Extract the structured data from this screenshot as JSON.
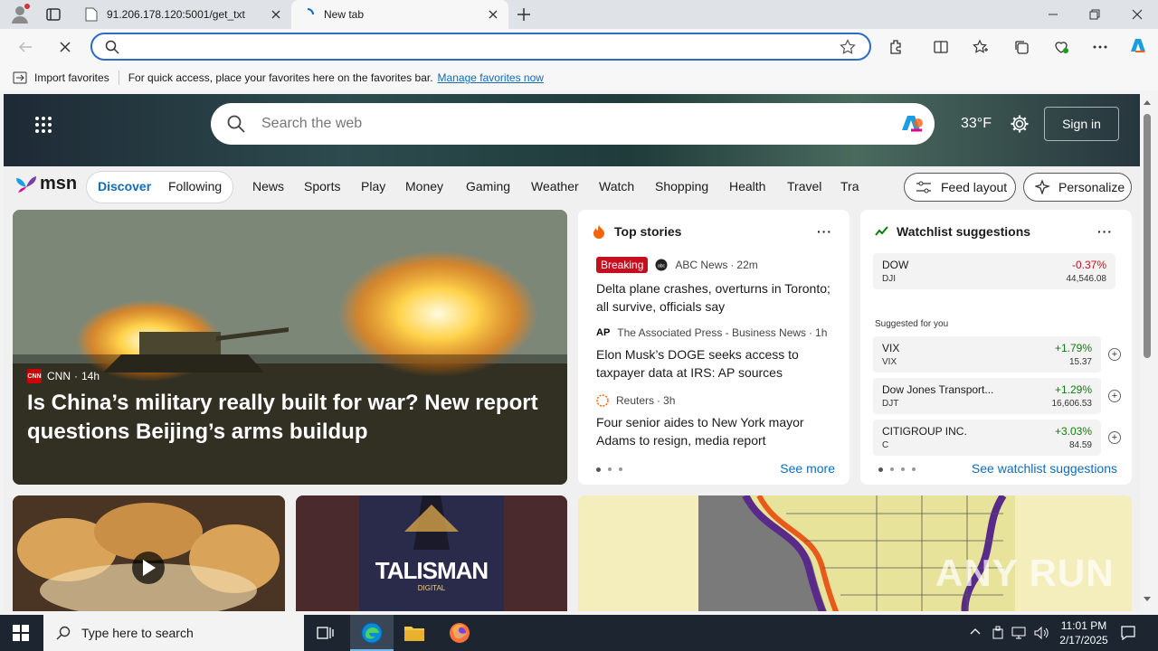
{
  "browser": {
    "tabs": [
      {
        "title": "91.206.178.120:5001/get_txt",
        "active": false
      },
      {
        "title": "New tab",
        "active": true
      }
    ],
    "address_value": "",
    "favorites_bar": {
      "import_label": "Import favorites",
      "message": "For quick access, place your favorites here on the favorites bar.",
      "link": "Manage favorites now"
    }
  },
  "msn": {
    "search_placeholder": "Search the web",
    "weather": "33°F",
    "sign_in": "Sign in",
    "logo": "msn",
    "pill_tabs": [
      "Discover",
      "Following"
    ],
    "nav": [
      "News",
      "Sports",
      "Play",
      "Money",
      "Gaming",
      "Weather",
      "Watch",
      "Shopping",
      "Health",
      "Travel",
      "Tra"
    ],
    "feed_layout": "Feed layout",
    "personalize": "Personalize",
    "hero": {
      "source": "CNN",
      "age": "14h",
      "title": "Is China’s military really built for war? New report questions Beijing’s arms buildup"
    },
    "top_stories": {
      "heading": "Top stories",
      "stories": [
        {
          "badge": "Breaking",
          "source": "ABC News",
          "age": "22m",
          "title": "Delta plane crashes, overturns in Toronto; all survive, officials say"
        },
        {
          "badge": "",
          "source": "The Associated Press - Business News",
          "age": "1h",
          "title": "Elon Musk’s DOGE seeks access to taxpayer data at IRS: AP sources"
        },
        {
          "badge": "",
          "source": "Reuters",
          "age": "3h",
          "title": "Four senior aides to New York mayor Adams to resign, media report"
        }
      ],
      "see_more": "See more"
    },
    "watchlist": {
      "heading": "Watchlist suggestions",
      "featured": {
        "name": "DOW",
        "symbol": "DJI",
        "change": "-0.37%",
        "value": "44,546.08"
      },
      "suggested_label": "Suggested for you",
      "items": [
        {
          "name": "VIX",
          "symbol": "VIX",
          "change": "+1.79%",
          "value": "15.37"
        },
        {
          "name": "Dow Jones Transport...",
          "symbol": "DJT",
          "change": "+1.29%",
          "value": "16,606.53"
        },
        {
          "name": "CITIGROUP INC.",
          "symbol": "C",
          "change": "+3.03%",
          "value": "84.59"
        }
      ],
      "link": "See watchlist suggestions"
    },
    "tile_text": "TALISMAN",
    "tile_subtext": "DIGITAL",
    "watermark": "ANY RUN"
  },
  "taskbar": {
    "search_placeholder": "Type here to search",
    "time": "11:01 PM",
    "date": "2/17/2025"
  },
  "colors": {
    "accent": "#0f6cbd",
    "negative": "#c50f1f",
    "positive": "#107c10",
    "breaking": "#c50f1f"
  }
}
